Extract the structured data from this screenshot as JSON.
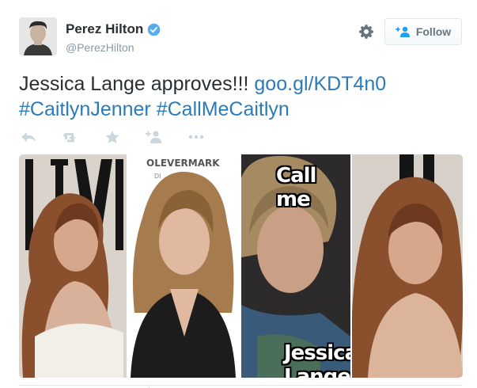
{
  "tweet": {
    "author_name": "Perez Hilton",
    "author_handle": "@PerezHilton",
    "text_plain": "Jessica Lange approves!!! ",
    "link": "goo.gl/KDT4n0",
    "hashtags": [
      "#CaitlynJenner",
      "#CallMeCaitlyn"
    ],
    "follow_label": "Follow"
  },
  "media": {
    "magazine_letters": "VANITY",
    "magazine_sign_text": "OLEVERMARK",
    "magazine_sign_text2": "DI",
    "caption_top": "Call me",
    "caption_bottom": "Jessica Lange"
  },
  "colors": {
    "link": "#2b7bb9",
    "text": "#292f33",
    "muted": "#8899a6",
    "verified": "#55acee",
    "action_icon": "#ccd6dd"
  },
  "icons": [
    "verified-badge-icon",
    "gear-icon",
    "follow-person-icon",
    "reply-icon",
    "retweet-icon",
    "favorite-icon",
    "follow-icon",
    "more-icon"
  ]
}
